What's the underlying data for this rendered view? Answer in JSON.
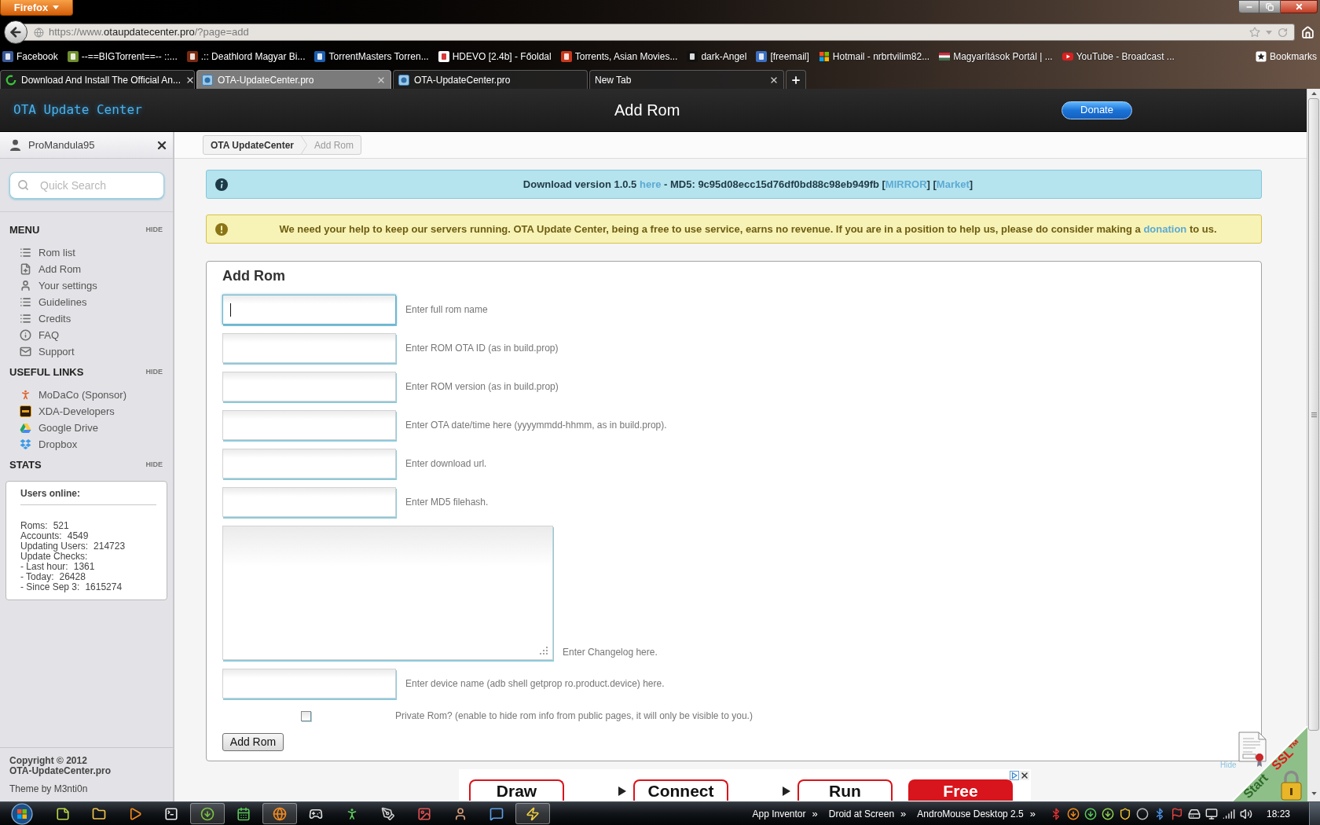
{
  "browser": {
    "menu_button": "Firefox",
    "address": {
      "prefix": "https://www.",
      "domain": "otaupdatecenter.pro",
      "path": "/?page=add"
    },
    "bookmarks": [
      "Facebook",
      "--==BIGTorrent==-- ::...",
      ".:: Deathlord Magyar Bi...",
      "TorrentMasters Torren...",
      "HDEVO [2.4b] - Főoldal",
      "Torrents, Asian Movies...",
      "dark-Angel",
      "[freemail]",
      "Hotmail - nrbrtvilim82...",
      "Magyarítások Portál | ...",
      "YouTube - Broadcast ..."
    ],
    "bookmarks_menu": "Bookmarks",
    "tabs": [
      {
        "label": "Download And Install The Official An...",
        "kind": "loading",
        "selected": false,
        "close_button": true
      },
      {
        "label": "OTA-UpdateCenter.pro",
        "kind": "site",
        "selected": true,
        "close_button": true
      },
      {
        "label": "OTA-UpdateCenter.pro",
        "kind": "site",
        "selected": false,
        "close_button": false
      },
      {
        "label": "New Tab",
        "kind": "blank",
        "selected": false,
        "close_button": true
      }
    ]
  },
  "header": {
    "logo": "OTA Update Center",
    "title": "Add Rom",
    "donate_button": "Donate"
  },
  "sidebar": {
    "user": "ProMandula95",
    "search_placeholder": "Quick Search",
    "sections": [
      {
        "kind": "menu",
        "title": "MENU",
        "hide": "HIDE",
        "items": [
          "Rom list",
          "Add Rom",
          "Your settings",
          "Guidelines",
          "Credits",
          "FAQ",
          "Support"
        ]
      },
      {
        "kind": "links",
        "title": "USEFUL LINKS",
        "hide": "HIDE",
        "items": [
          "MoDaCo (Sponsor)",
          "XDA-Developers",
          "Google Drive",
          "Dropbox"
        ]
      },
      {
        "kind": "stats",
        "title": "STATS",
        "hide": "HIDE",
        "heading": "Users online:",
        "rows": [
          {
            "label": "Roms:",
            "value": "521"
          },
          {
            "label": "Accounts:",
            "value": "4549"
          },
          {
            "label": "Updating Users:",
            "value": "214723"
          },
          {
            "label": "Update Checks:"
          },
          {
            "label": "- Last hour:",
            "value": "1361"
          },
          {
            "label": "- Today:",
            "value": "26428"
          },
          {
            "label": "- Since Sep 3:",
            "value": "1615274"
          }
        ]
      }
    ],
    "footer": {
      "lines": [
        "Copyright © 2012",
        "OTA-UpdateCenter.pro"
      ],
      "theme": "Theme by M3nti0n"
    }
  },
  "breadcrumb": [
    {
      "label": "OTA UpdateCenter",
      "selected": false
    },
    {
      "label": "Add Rom",
      "selected": true
    }
  ],
  "notices": [
    {
      "kind": "info",
      "parts": [
        {
          "kind": "text",
          "text": "Download version 1.0.5 "
        },
        {
          "kind": "link",
          "text": "here"
        },
        {
          "kind": "text",
          "text": " - MD5: 9c95d08ecc15d76df0bd88c98eb949fb ["
        },
        {
          "kind": "link",
          "text": "MIRROR"
        },
        {
          "kind": "text",
          "text": "] ["
        },
        {
          "kind": "link",
          "text": "Market"
        },
        {
          "kind": "text",
          "text": "]"
        }
      ]
    },
    {
      "kind": "warning",
      "parts": [
        {
          "kind": "text",
          "text": "We need your help to keep our servers running. OTA Update Center, being a free to use service, earns no revenue. If you are in a position to help us, please do consider making a "
        },
        {
          "kind": "link",
          "text": "donation"
        },
        {
          "kind": "text",
          "text": " to us."
        }
      ]
    }
  ],
  "form": {
    "title": "Add Rom",
    "fields": [
      {
        "kind": "input",
        "label": "Enter full rom name",
        "focused": true
      },
      {
        "kind": "input",
        "label": "Enter ROM OTA ID (as in build.prop)",
        "focused": false
      },
      {
        "kind": "input",
        "label": "Enter ROM version (as in build.prop)",
        "focused": false
      },
      {
        "kind": "input",
        "label": "Enter OTA date/time here (yyyymmdd-hhmm, as in build.prop).",
        "focused": false
      },
      {
        "kind": "input",
        "label": "Enter download url.",
        "focused": false
      },
      {
        "kind": "input",
        "label": "Enter MD5 filehash.",
        "focused": false
      },
      {
        "kind": "textarea",
        "label": "Enter Changelog here.",
        "focused": false
      },
      {
        "kind": "input",
        "label": "Enter device name (adb shell getprop ro.product.device) here.",
        "focused": false
      }
    ],
    "private": {
      "label": "Private Rom? (enable to hide rom info from public pages, it will only be visible to you.)",
      "checked": false
    },
    "submit_button": "Add Rom"
  },
  "ad": {
    "steps": [
      {
        "label": "Draw",
        "kind": "outline",
        "arrow": false
      },
      {
        "label": "Connect",
        "kind": "outline",
        "arrow": true
      },
      {
        "label": "Run",
        "kind": "outline",
        "arrow": true
      },
      {
        "label": "Free",
        "kind": "filled",
        "arrow": false
      }
    ]
  },
  "ssl_badge": {
    "word_1": "Start",
    "word_2": "SSL™",
    "hide_link": "Hide"
  },
  "taskbar": {
    "apps": [
      {
        "active": false
      },
      {
        "active": false
      },
      {
        "active": false
      },
      {
        "active": false
      },
      {
        "active": true
      },
      {
        "active": false
      },
      {
        "active": true
      },
      {
        "active": false
      },
      {
        "active": false
      },
      {
        "active": false
      },
      {
        "active": false
      },
      {
        "active": false
      },
      {
        "active": false
      },
      {
        "active": true
      }
    ],
    "toolbars": [
      {
        "label": "App Inventor",
        "chevron": "»"
      },
      {
        "label": "Droid at Screen",
        "chevron": "»"
      },
      {
        "label": "AndroMouse Desktop 2.5",
        "chevron": "»"
      }
    ],
    "clock": "18:23"
  }
}
